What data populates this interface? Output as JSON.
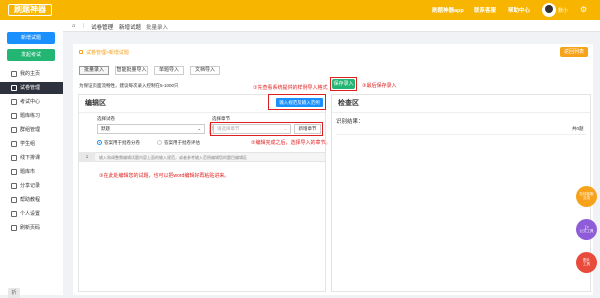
{
  "app": {
    "logo": "刷题神器"
  },
  "topnav": {
    "app_link": "刷题神器app",
    "support": "联系客服",
    "help": "帮助中心",
    "username": "默小"
  },
  "sidebar": {
    "btn_new_test": "新增试题",
    "btn_new_exam": "发起考试",
    "items": [
      {
        "label": "我的主页"
      },
      {
        "label": "试卷管理"
      },
      {
        "label": "考试中心"
      },
      {
        "label": "题库练习"
      },
      {
        "label": "群组管理"
      },
      {
        "label": "学生组"
      },
      {
        "label": "线下排课"
      },
      {
        "label": "题库市"
      },
      {
        "label": "分享记录"
      },
      {
        "label": "帮助教程"
      },
      {
        "label": "个人设置"
      },
      {
        "label": "刷新页码"
      }
    ],
    "collapse": "折"
  },
  "breadcrumb": {
    "home": "⌂",
    "sep": "|",
    "level1": "试卷管理",
    "level2": "新增试题",
    "level3": "批量录入"
  },
  "page": {
    "back_link": "试卷管理>新增试题",
    "return_btn": "返回列表",
    "tabs": [
      "批量录入",
      "智能批量导入",
      "单题导入",
      "文档导入"
    ],
    "hint": "为保证页面流畅性，建议每次录入控制在5-1000只",
    "save_btn": "保存录入"
  },
  "editor": {
    "title": "编辑区",
    "template_btn": "输入规范及输入范例",
    "select_test_label": "选择试卷",
    "select_test_value": "默题",
    "new_test_btn": "新增试卷",
    "select_chapter_label": "选择章节",
    "select_chapter_placeholder": "请选择章节",
    "new_chapter_btn": "新增章节",
    "radio1": "答案用于批卷分卷",
    "radio2": "答案用于批卷评估",
    "line_number": "1",
    "textarea_placeholder": "输入和调整需编辑试题内容上面的输入规范，或者参考输入范例编辑您的题目编辑区"
  },
  "checker": {
    "title": "检查区",
    "result_label": "识别结果：",
    "count": "共0题"
  },
  "annotations": {
    "note1": "①先查看系统提供的样例导入格式",
    "note2": "②编辑完成之后，选择导入的章节。",
    "note3": "③最后保存录入",
    "note4": "③在此处编辑您的试题，也可以把word编辑好再粘贴进来。"
  },
  "floats": [
    {
      "label": "在线客服\n交流"
    },
    {
      "label": "∑x\n公式工具"
    },
    {
      "label": "图片\n工具"
    }
  ],
  "colors": {
    "topbar": "#f7b500",
    "accent_orange": "#f7a21b",
    "accent_blue": "#1a90ff",
    "sidebar_active": "#2e323f",
    "annotation": "#e02020"
  }
}
